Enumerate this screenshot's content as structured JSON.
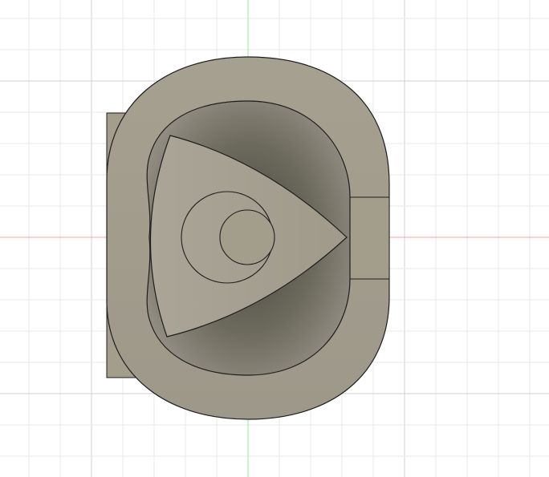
{
  "viewport": {
    "background": "#ffffff",
    "grid_color_minor": "#e8e8e8",
    "grid_color_major": "#d2d2d2",
    "x_axis_color": "#f4a6a6",
    "y_axis_color": "#9ee89e"
  },
  "model": {
    "name": "rotary-engine",
    "body_color": "#a39d8c",
    "cavity_color": "#5a574b",
    "outline_color": "#1e1e1e"
  }
}
